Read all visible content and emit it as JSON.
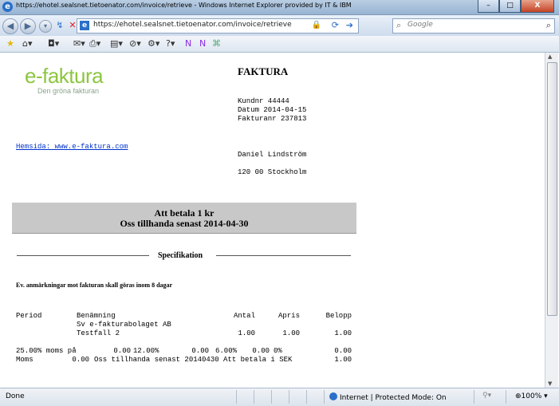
{
  "window": {
    "title": "https://ehotel.sealsnet.tietoenator.com/invoice/retrieve - Windows Internet Explorer provided by IT & IBM",
    "minimize": "–",
    "maximize": "□",
    "close": "X"
  },
  "address": {
    "url": "https://ehotel.sealsnet.tietoenator.com/invoice/retrieve",
    "search_placeholder": "Google"
  },
  "status": {
    "left": "Done",
    "zone": "Internet | Protected Mode: On",
    "zoom": "100%"
  },
  "invoice": {
    "logo": "e-faktura",
    "tagline": "Den gröna fakturan",
    "title": "FAKTURA",
    "kundnr": "Kundnr 44444",
    "datum": "Datum 2014-04-15",
    "fakturanr": "Fakturanr 237813",
    "homepage": "Hemsida: www.e-faktura.com",
    "customer_name": "Daniel Lindström",
    "customer_address": "120 00 Stockholm",
    "amount_due": "Att betala 1 kr",
    "due_date": "Oss tillhanda senast 2014-04-30",
    "spec_title": "Specifikation",
    "note": "Ev. anmärkningar mot fakturan skall göras inom 8 dagar",
    "columns": {
      "period": "Period",
      "benamning": "Benämning",
      "antal": "Antal",
      "apris": "Apris",
      "belopp": "Belopp"
    },
    "company_line": "Sv e-fakturabolaget AB",
    "item": {
      "name": "Testfall 2",
      "antal": "1.00",
      "apris": "1.00",
      "belopp": "1.00"
    },
    "vat_row": {
      "label": "25.00% moms på",
      "v1": "0.00",
      "p2": "12.00%",
      "v2": "0.00",
      "p3": "6.00%",
      "v3": "0.00",
      "p4": "0%",
      "total": "0.00"
    },
    "moms_row": {
      "label": "Moms",
      "value": "0.00",
      "text": "Oss tillhanda senast 20140430 Att betala i SEK",
      "total": "1.00"
    }
  }
}
